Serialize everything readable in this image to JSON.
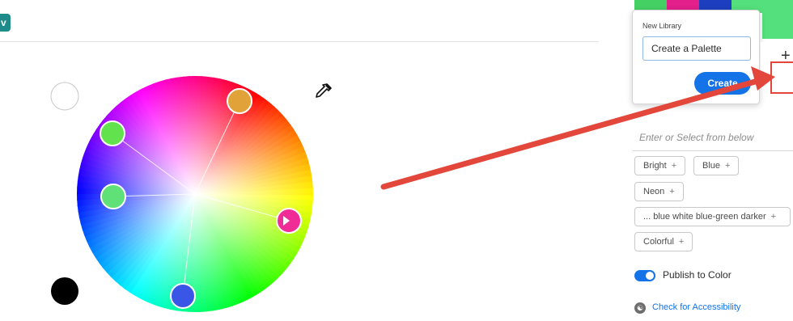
{
  "top_button": {
    "label": "v"
  },
  "colors": {
    "accent": "#1473e6",
    "arrow": "#e3463b",
    "swatches": [
      "#45d064",
      "#e21f8a",
      "#1d3fbf",
      "#54e07c"
    ]
  },
  "new_library_popup": {
    "title": "New Library",
    "input_value": "Create a Palette",
    "create_label": "Create"
  },
  "add_button": {
    "label": "+"
  },
  "tags": {
    "placeholder": "Enter or Select from below",
    "items": [
      {
        "label": "Bright"
      },
      {
        "label": "Blue"
      },
      {
        "label": "Neon"
      },
      {
        "label": "... blue white blue-green darker"
      },
      {
        "label": "Colorful"
      }
    ]
  },
  "publish": {
    "label": "Publish to Color",
    "enabled": true
  },
  "accessibility": {
    "icon": "accessibility-icon",
    "label": "Check for Accessibility"
  }
}
